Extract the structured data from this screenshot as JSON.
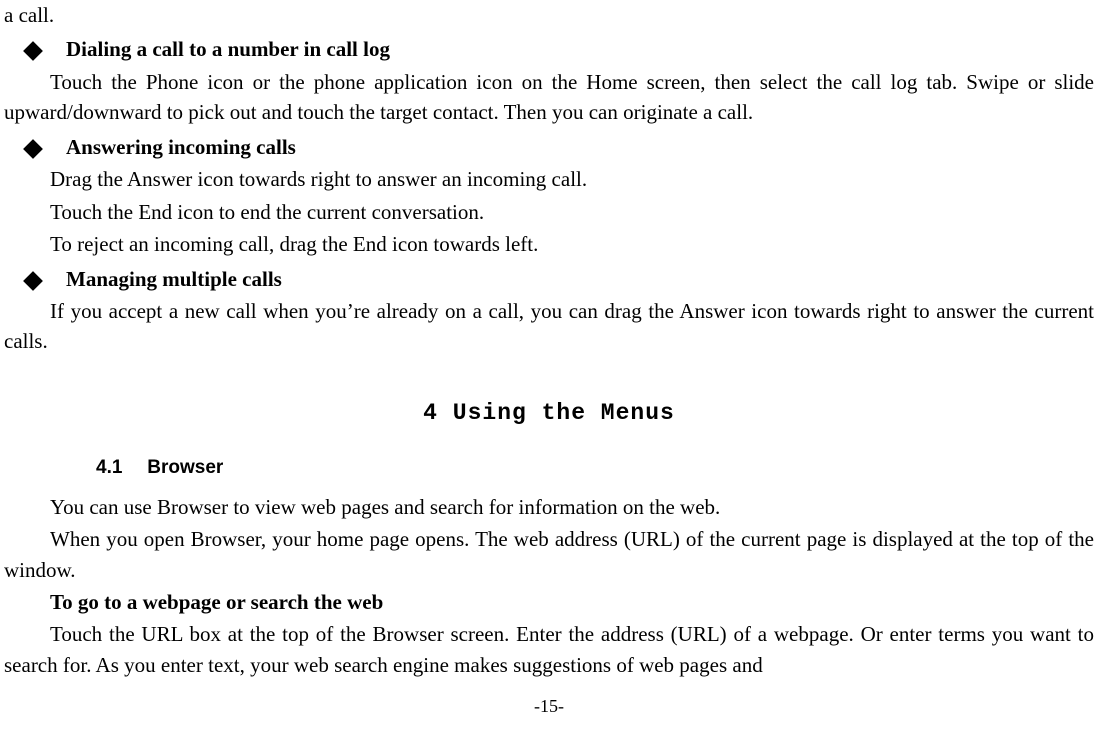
{
  "frag_top": "a call.",
  "bullets": [
    {
      "title": "Dialing a call to a number in call log",
      "paras": [
        "Touch the Phone icon or the phone application icon on the Home screen, then select the call log tab. Swipe or slide upward/downward to pick out and touch the target contact. Then you can originate a call."
      ]
    },
    {
      "title": "Answering incoming calls",
      "paras": [
        "Drag the Answer icon towards right to answer an incoming call.",
        "Touch the End icon to end the current conversation.",
        "To reject an incoming call, drag the End icon towards left."
      ]
    },
    {
      "title": "Managing multiple calls",
      "paras": [
        "If you accept a new call when you’re already on a call, you can drag the Answer icon towards right to answer the current calls."
      ]
    }
  ],
  "section": {
    "number": "4",
    "title": "Using the Menus"
  },
  "subsection": {
    "number": "4.1",
    "title": "Browser"
  },
  "browser_text": [
    "You can use Browser to view web pages and search for information on the web.",
    "When you open Browser, your home page opens. The web address (URL) of the current page is displayed at the top of the window."
  ],
  "browser_bold_heading": "To go to a webpage or search the web",
  "browser_tail": "Touch the URL box at the top of the Browser screen. Enter the address (URL) of a webpage. Or enter terms you want to search for. As you enter text, your web search engine makes suggestions of web pages and",
  "page_number": "-15-"
}
